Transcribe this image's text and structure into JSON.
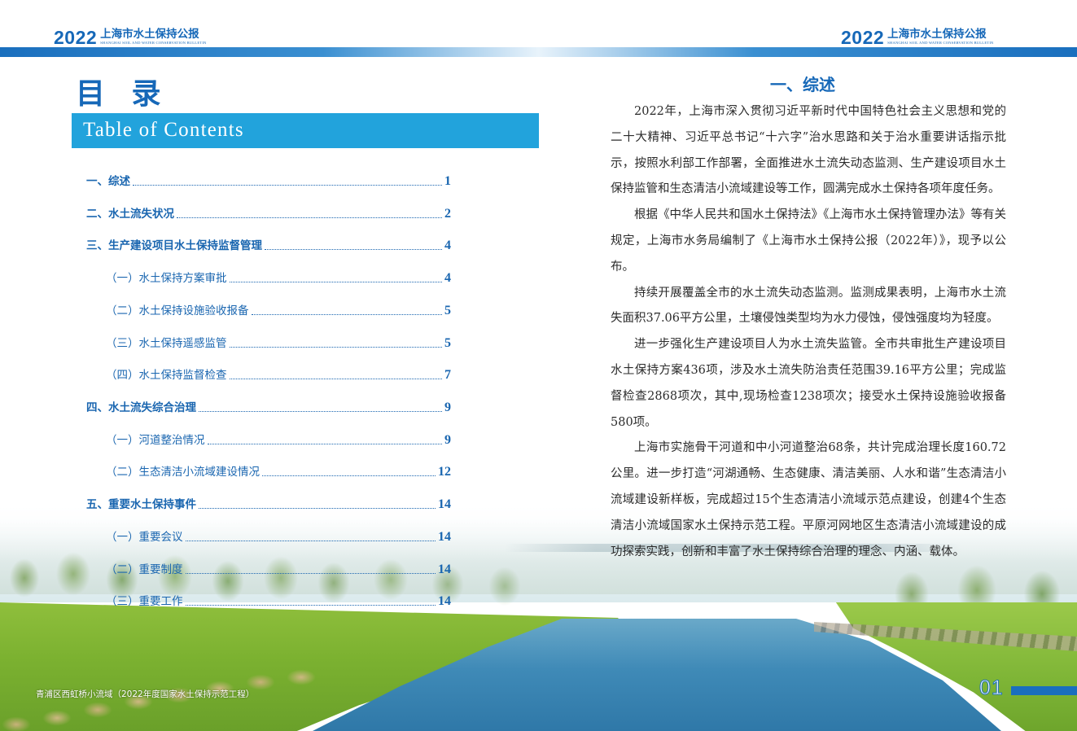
{
  "header": {
    "year": "2022",
    "title_cn": "上海市水土保持公报",
    "title_en": "SHANGHAI SOIL AND WATER CONSERVATION BULLETIN"
  },
  "toc": {
    "title": "目 录",
    "subtitle": "Table of Contents",
    "entries": [
      {
        "label": "一、综述",
        "page": "1"
      },
      {
        "label": "二、水土流失状况",
        "page": "2"
      },
      {
        "label": "三、生产建设项目水土保持监督管理",
        "page": "4"
      },
      {
        "label": "（一）水土保持方案审批",
        "page": "4"
      },
      {
        "label": "（二）水土保持设施验收报备",
        "page": "5"
      },
      {
        "label": "（三）水土保持遥感监管",
        "page": "5"
      },
      {
        "label": "（四）水土保持监督检查",
        "page": "7"
      },
      {
        "label": "四、水土流失综合治理",
        "page": "9"
      },
      {
        "label": "（一）河道整治情况",
        "page": "9"
      },
      {
        "label": "（二）生态清洁小流域建设情况",
        "page": "12"
      },
      {
        "label": "五、重要水土保持事件",
        "page": "14"
      },
      {
        "label": "（一）重要会议",
        "page": "14"
      },
      {
        "label": "（二）重要制度",
        "page": "14"
      },
      {
        "label": "（三）重要工作",
        "page": "14"
      }
    ]
  },
  "overview": {
    "heading": "一、综述",
    "paragraphs": [
      "2022年，上海市深入贯彻习近平新时代中国特色社会主义思想和党的二十大精神、习近平总书记“十六字”治水思路和关于治水重要讲话指示批示，按照水利部工作部署，全面推进水土流失动态监测、生产建设项目水土保持监管和生态清洁小流域建设等工作，圆满完成水土保持各项年度任务。",
      "根据《中华人民共和国水土保持法》《上海市水土保持管理办法》等有关规定，上海市水务局编制了《上海市水土保持公报（2022年）》，现予以公布。",
      "持续开展覆盖全市的水土流失动态监测。监测成果表明，上海市水土流失面积37.06平方公里，土壤侵蚀类型均为水力侵蚀，侵蚀强度均为轻度。",
      "进一步强化生产建设项目人为水土流失监管。全市共审批生产建设项目水土保持方案436项，涉及水土流失防治责任范围39.16平方公里；完成监督检查2868项次，其中,现场检查1238项次；接受水土保持设施验收报备580项。",
      "上海市实施骨干河道和中小河道整治68条，共计完成治理长度160.72公里。进一步打造“河湖通畅、生态健康、清洁美丽、人水和谐”生态清洁小流域建设新样板，完成超过15个生态清洁小流域示范点建设，创建4个生态清洁小流域国家水土保持示范工程。平原河网地区生态清洁小流域建设的成功探索实践，创新和丰富了水土保持综合治理的理念、内涵、载体。"
    ]
  },
  "footer": {
    "caption": "青浦区西虹桥小流域（2022年度国家水土保持示范工程）",
    "page_number": "01"
  }
}
